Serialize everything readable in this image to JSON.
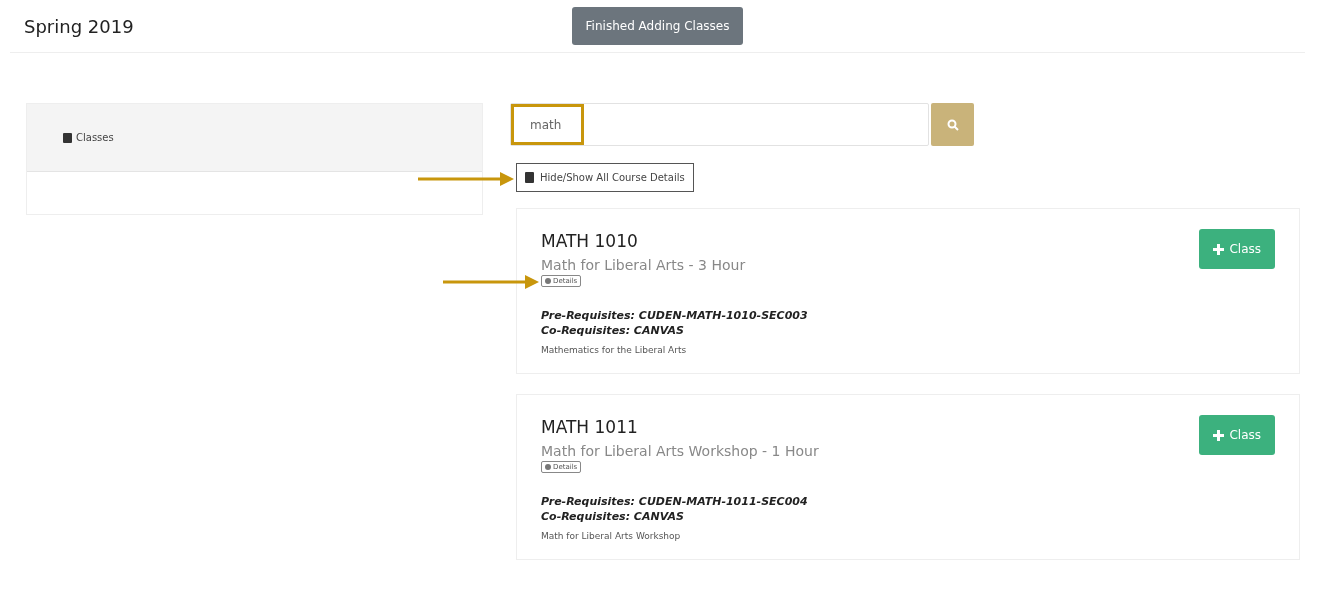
{
  "header": {
    "title": "Spring 2019",
    "finish_button": "Finished Adding Classes"
  },
  "sidebar": {
    "tab": "Classes"
  },
  "search": {
    "value": "math",
    "highlighted": true
  },
  "toggle_button": {
    "label": "Hide/Show All Course Details",
    "annotated": true
  },
  "courses": [
    {
      "code": "MATH 1010",
      "title": "Math for Liberal Arts - 3 Hour",
      "details_button": "Details",
      "annotated": true,
      "prerequisites": "Pre-Requisites: CUDEN-MATH-1010-SEC003",
      "corequisites": "Co-Requisites: CANVAS",
      "description": "Mathematics for the Liberal Arts",
      "add_button": "Class"
    },
    {
      "code": "MATH 1011",
      "title": "Math for Liberal Arts Workshop - 1 Hour",
      "details_button": "Details",
      "annotated": false,
      "prerequisites": "Pre-Requisites: CUDEN-MATH-1011-SEC004",
      "corequisites": "Co-Requisites: CANVAS",
      "description": "Math for Liberal Arts Workshop",
      "add_button": "Class"
    }
  ]
}
